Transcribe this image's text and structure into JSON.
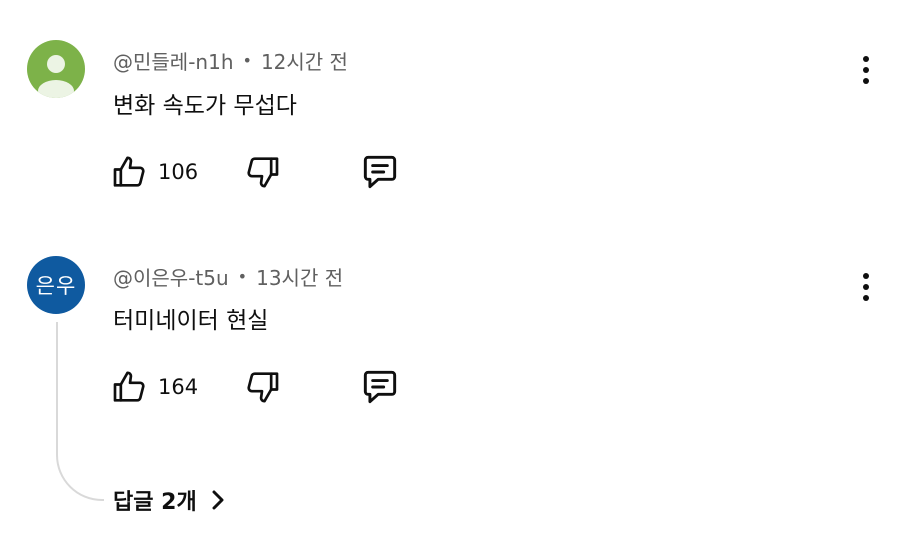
{
  "comments": [
    {
      "author": "@민들레-n1h",
      "separator": "•",
      "time": "12시간 전",
      "text": "변화 속도가 무섭다",
      "likes": "106",
      "avatar_color": "#7db249",
      "avatar_icon": "default-person-icon"
    },
    {
      "author": "@이은우-t5u",
      "separator": "•",
      "time": "13시간 전",
      "text": "터미네이터 현실",
      "likes": "164",
      "avatar_text": "은우",
      "avatar_color": "#0f5aa0",
      "replies_label": "답글 2개"
    }
  ],
  "icons": {
    "like": "thumbs-up-icon",
    "dislike": "thumbs-down-icon",
    "reply": "reply-comment-icon",
    "more": "more-vertical-icon",
    "expand": "chevron-right-icon"
  }
}
